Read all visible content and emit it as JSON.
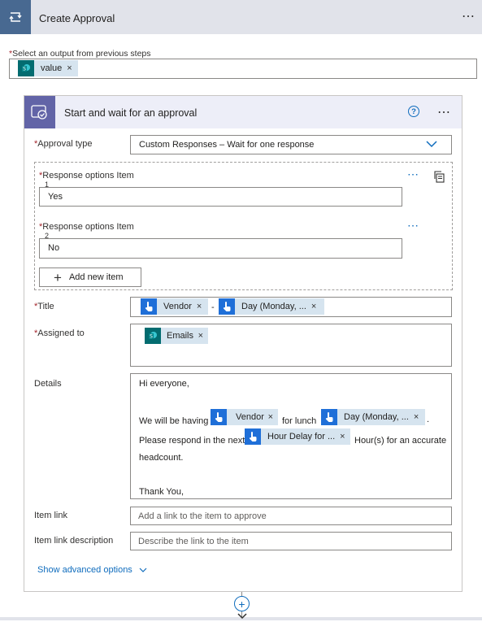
{
  "action": {
    "title": "Create Approval",
    "more": "⋯"
  },
  "output_select": {
    "label": "Select an output from previous steps",
    "required": "*",
    "token": "value"
  },
  "approval": {
    "title": "Start and wait for an approval",
    "help": "?",
    "more": "⋯",
    "approval_type": {
      "label": "Approval type",
      "value": "Custom Responses – Wait for one response"
    },
    "response_options": [
      {
        "label": "Response options Item",
        "index": "1",
        "value": "Yes"
      },
      {
        "label": "Response options Item",
        "index": "2",
        "value": "No"
      }
    ],
    "add_item": "Add new item",
    "title_field": {
      "label": "Title",
      "tokens": [
        "Vendor",
        "Day (Monday, ..."
      ],
      "separator": "-"
    },
    "assigned_to": {
      "label": "Assigned to",
      "tokens": [
        "Emails"
      ]
    },
    "details": {
      "label": "Details",
      "greeting": "Hi everyone,",
      "line2_prefix": "We will be having",
      "token_vendor": "Vendor",
      "line2_mid": "for lunch",
      "token_day": "Day (Monday, ...",
      "line2_suffix": ".",
      "line3_prefix": "Please respond in the next",
      "token_hours": "Hour Delay for ...",
      "line3_suffix": "Hour(s) for an accurate",
      "line4": "headcount.",
      "signoff": "Thank You,"
    },
    "item_link": {
      "label": "Item link",
      "placeholder": "Add a link to the item to approve"
    },
    "item_link_description": {
      "label": "Item link description",
      "placeholder": "Describe the link to the item"
    },
    "show_advanced": "Show advanced options"
  },
  "connector": {
    "plus": "+"
  },
  "token_remove": "×",
  "colors": {
    "accent": "#0f6cbd",
    "approval_brand": "#6264a7",
    "token_bg": "#d6e4ef",
    "sharepoint": "#036c70",
    "trigger": "#1f6fd8"
  },
  "icons": {
    "action": "loop-icon",
    "approval": "approval-icon",
    "sharepoint": "sharepoint-icon",
    "trigger": "hand-pointer-icon",
    "copy": "copy-icon",
    "chevron": "chevron-down-icon"
  }
}
